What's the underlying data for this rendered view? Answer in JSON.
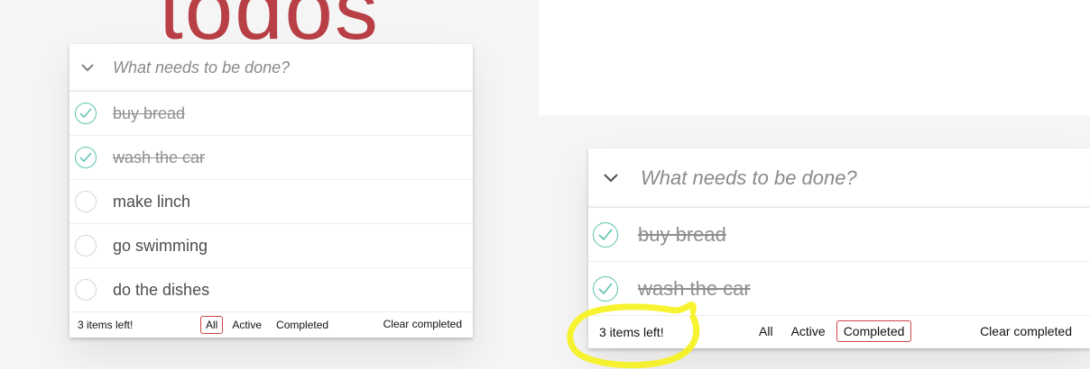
{
  "left": {
    "title": "todos",
    "new_todo_placeholder": "What needs to be done?",
    "items": [
      {
        "text": "buy bread",
        "completed": true
      },
      {
        "text": "wash the car",
        "completed": true
      },
      {
        "text": "make linch",
        "completed": false
      },
      {
        "text": "go swimming",
        "completed": false
      },
      {
        "text": "do the dishes",
        "completed": false
      }
    ],
    "footer": {
      "count_label": "3 items left!",
      "filters": [
        {
          "label": "All",
          "selected": true
        },
        {
          "label": "Active",
          "selected": false
        },
        {
          "label": "Completed",
          "selected": false
        }
      ],
      "clear_label": "Clear completed"
    }
  },
  "right": {
    "new_todo_placeholder": "What needs to be done?",
    "items": [
      {
        "text": "buy bread",
        "completed": true
      },
      {
        "text": "wash the car",
        "completed": true
      }
    ],
    "footer": {
      "count_label": "3 items left!",
      "filters": [
        {
          "label": "All",
          "selected": false
        },
        {
          "label": "Active",
          "selected": false
        },
        {
          "label": "Completed",
          "selected": true
        }
      ],
      "clear_label": "Clear completed"
    }
  },
  "icons": {
    "toggle_all": "chevron-down-icon",
    "checked": "checkmark-icon"
  },
  "colors": {
    "title": "#b83f45",
    "check": "#5dc2af",
    "selected_filter_border": "#ce4646",
    "highlight": "#f7f21a"
  }
}
